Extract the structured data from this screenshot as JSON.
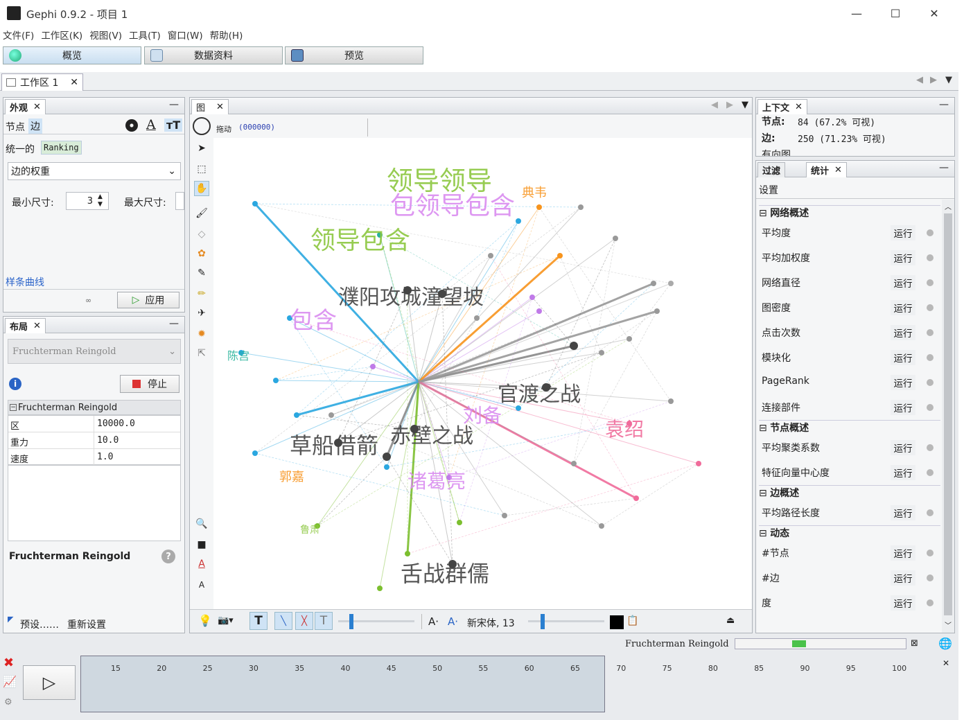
{
  "window": {
    "title": "Gephi 0.9.2 - 项目 1",
    "minimize": "—",
    "maximize": "☐",
    "close": "✕"
  },
  "menu": [
    "文件(F)",
    "工作区(K)",
    "视图(V)",
    "工具(T)",
    "窗口(W)",
    "帮助(H)"
  ],
  "modes": {
    "overview": "概览",
    "data": "数据资料",
    "preview": "预览"
  },
  "workspace_tab": {
    "label": "工作区 1",
    "close": "✕"
  },
  "appearance": {
    "tab": "外观",
    "close": "✕",
    "node_tab": "节点",
    "edge_tab": "边",
    "unique": "统一的",
    "ranking": "Ranking",
    "attribute_select": "边的权重",
    "min_size_label": "最小尺寸:",
    "min_size_value": "3",
    "max_size_label": "最大尺寸:",
    "spline_link": "样条曲线",
    "apply": "应用"
  },
  "layout": {
    "tab": "布局",
    "close": "✕",
    "algorithm": "Fruchterman Reingold",
    "stop": "停止",
    "group_label": "Fruchterman Reingold",
    "props": [
      {
        "name": "区",
        "value": "10000.0"
      },
      {
        "name": "重力",
        "value": "10.0"
      },
      {
        "name": "速度",
        "value": "1.0"
      }
    ],
    "desc_title": "Fruchterman Reingold",
    "presets": "预设……",
    "reset": "重新设置"
  },
  "graph": {
    "tab": "图",
    "close": "✕",
    "drag_label": "拖动",
    "drag_value": "(000000)",
    "font_label": "新宋体,  13"
  },
  "context": {
    "tab": "上下文",
    "close": "✕",
    "nodes_label": "节点:",
    "nodes_value": "84 (67.2% 可视)",
    "edges_label": "边:",
    "edges_value": "250 (71.23% 可视)",
    "directed": "有向图"
  },
  "statistics": {
    "filter_tab": "过滤",
    "stats_tab": "统计",
    "close": "✕",
    "settings": "设置",
    "run_label": "运行",
    "sections": [
      {
        "title": "网络概述",
        "items": [
          "平均度",
          "平均加权度",
          "网络直径",
          "图密度",
          "点击次数",
          "模块化",
          "PageRank",
          "连接部件"
        ]
      },
      {
        "title": "节点概述",
        "items": [
          "平均聚类系数",
          "特征向量中心度"
        ]
      },
      {
        "title": "边概述",
        "items": [
          "平均路径长度"
        ]
      },
      {
        "title": "动态",
        "items": [
          "#节点",
          "#边",
          "度"
        ]
      }
    ]
  },
  "status": {
    "running_algo": "Fruchterman Reingold"
  },
  "timeline": {
    "ticks": [
      "15",
      "20",
      "25",
      "30",
      "35",
      "40",
      "45",
      "50",
      "55",
      "60",
      "65",
      "70",
      "75",
      "80",
      "85",
      "90",
      "95",
      "100"
    ]
  },
  "labels_big": [
    {
      "t": "领导领导",
      "c": "#8cc63f"
    },
    {
      "t": "包领导包含",
      "c": "#d98cf0"
    },
    {
      "t": "领导包含",
      "c": "#8cc63f"
    },
    {
      "t": "包含",
      "c": "#d98cf0"
    },
    {
      "t": "濮阳攻城潼望坡",
      "c": "#444"
    },
    {
      "t": "官渡之战",
      "c": "#444"
    },
    {
      "t": "草船借箭",
      "c": "#444"
    },
    {
      "t": "赤壁之战",
      "c": "#444"
    },
    {
      "t": "舌战群儒",
      "c": "#444"
    },
    {
      "t": "袁绍",
      "c": "#f06b9a"
    },
    {
      "t": "郭嘉",
      "c": "#f7941d"
    },
    {
      "t": "陈宫",
      "c": "#28b29a"
    },
    {
      "t": "典韦",
      "c": "#f7941d"
    },
    {
      "t": "诸葛亮",
      "c": "#d98cf0"
    },
    {
      "t": "刘备",
      "c": "#d98cf0"
    },
    {
      "t": "鲁肃",
      "c": "#8cc63f"
    }
  ],
  "colors": {
    "accent": "#2aa7e0",
    "purple": "#c07ae8",
    "green": "#7cbf2f"
  }
}
